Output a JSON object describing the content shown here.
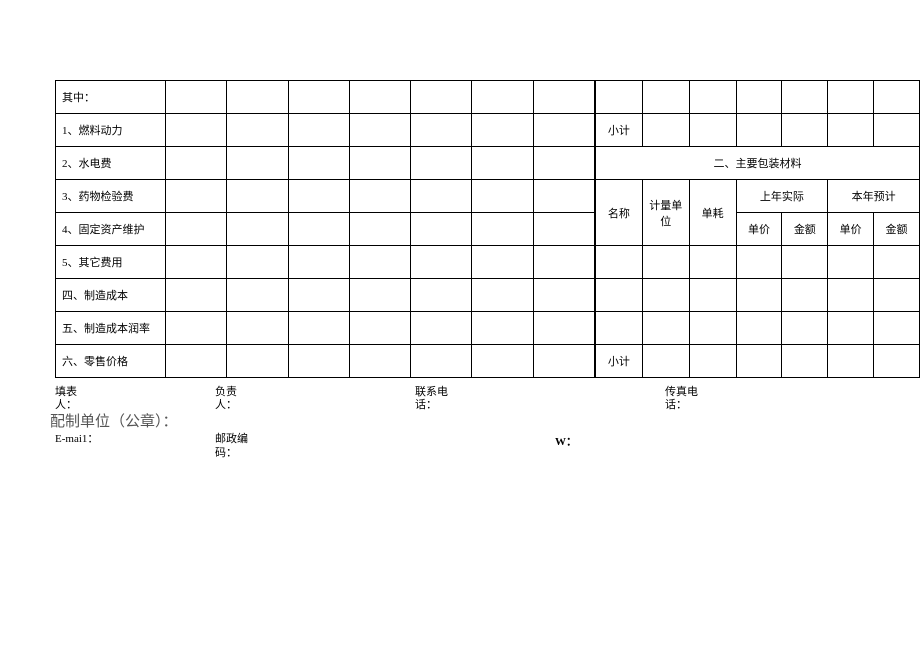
{
  "leftRows": {
    "r1": "其中：",
    "r2": "1、燃料动力",
    "r3": "2、水电费",
    "r4": "3、药物检验费",
    "r5": "4、固定资产维护",
    "r6": "5、其它费用",
    "r7": "四、制造成本",
    "r8": "五、制造成本润率",
    "r9": "六、零售价格"
  },
  "right": {
    "subtotal": "小计",
    "sectionTitle": "二、主要包装材料",
    "name": "名称",
    "unit": "计量单位",
    "consume": "单耗",
    "lastYear": "上年实际",
    "thisYear": "本年预计",
    "unitPrice": "单价",
    "amount": "金额"
  },
  "footer": {
    "filler1": "填表",
    "filler2": "人：",
    "resp1": "负责",
    "resp2": "人：",
    "phone1": "联系电",
    "phone2": "话：",
    "fax1": "传真电",
    "fax2": "话：",
    "org": "配制单位（公章）：",
    "email": "E-mai1：",
    "post1": "邮政编",
    "post2": "码：",
    "w": "W："
  }
}
